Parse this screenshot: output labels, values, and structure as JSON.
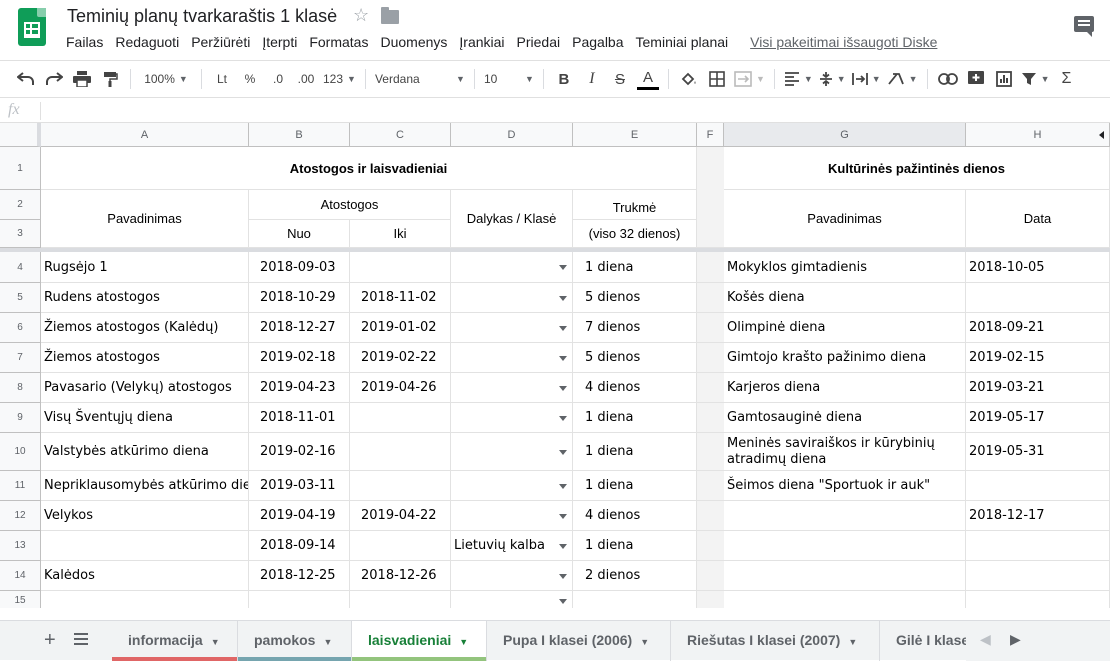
{
  "header": {
    "doc_title": "Teminių planų tvarkaraštis 1 klasė",
    "menu": [
      "Failas",
      "Redaguoti",
      "Peržiūrėti",
      "Įterpti",
      "Formatas",
      "Duomenys",
      "Įrankiai",
      "Priedai",
      "Pagalba",
      "Teminiai planai"
    ],
    "saved_status": "Visi pakeitimai išsaugoti Diske"
  },
  "toolbar": {
    "zoom": "100%",
    "currency": "Lt",
    "percent": "%",
    "dec_less": ".0",
    "dec_more": ".00",
    "number_format": "123",
    "font": "Verdana",
    "font_size": "10",
    "bold": "B",
    "italic": "I",
    "strike": "S",
    "text_color": "A"
  },
  "formula_bar": {
    "fx": "fx",
    "value": ""
  },
  "columns": [
    "A",
    "B",
    "C",
    "D",
    "E",
    "F",
    "G",
    "H"
  ],
  "rows": [
    "1",
    "2",
    "3",
    "4",
    "5",
    "6",
    "7",
    "8",
    "9",
    "10",
    "11",
    "12",
    "13",
    "14",
    "15"
  ],
  "left_table": {
    "title": "Atostogos ir laisvadieniai",
    "h_name": "Pavadinimas",
    "h_vacation": "Atostogos",
    "h_from": "Nuo",
    "h_to": "Iki",
    "h_subject": "Dalykas / Klasė",
    "h_duration": "Trukmė",
    "h_duration_sub": "(viso 32 dienos)",
    "rows": [
      {
        "name": "Rugsėjo 1",
        "from": "2018-09-03",
        "to": "",
        "subject": "",
        "duration": "1 diena"
      },
      {
        "name": "Rudens atostogos",
        "from": "2018-10-29",
        "to": "2018-11-02",
        "subject": "",
        "duration": "5 dienos"
      },
      {
        "name": "Žiemos atostogos (Kalėdų)",
        "from": "2018-12-27",
        "to": "2019-01-02",
        "subject": "",
        "duration": "7 dienos"
      },
      {
        "name": "Žiemos atostogos",
        "from": "2019-02-18",
        "to": "2019-02-22",
        "subject": "",
        "duration": "5 dienos"
      },
      {
        "name": "Pavasario (Velykų) atostogos",
        "from": "2019-04-23",
        "to": "2019-04-26",
        "subject": "",
        "duration": "4 dienos"
      },
      {
        "name": "Visų Šventųjų diena",
        "from": "2018-11-01",
        "to": "",
        "subject": "",
        "duration": "1 diena"
      },
      {
        "name": "Valstybės atkūrimo diena",
        "from": "2019-02-16",
        "to": "",
        "subject": "",
        "duration": "1 diena"
      },
      {
        "name": "Nepriklausomybės atkūrimo diena",
        "from": "2019-03-11",
        "to": "",
        "subject": "",
        "duration": "1 diena"
      },
      {
        "name": "Velykos",
        "from": "2019-04-19",
        "to": "2019-04-22",
        "subject": "",
        "duration": "4 dienos"
      },
      {
        "name": "",
        "from": "2018-09-14",
        "to": "",
        "subject": "Lietuvių kalba",
        "duration": "1 diena"
      },
      {
        "name": "Kalėdos",
        "from": "2018-12-25",
        "to": "2018-12-26",
        "subject": "",
        "duration": "2 dienos"
      },
      {
        "name": "",
        "from": "",
        "to": "",
        "subject": "",
        "duration": ""
      }
    ]
  },
  "right_table": {
    "title": "Kultūrinės pažintinės dienos",
    "h_name": "Pavadinimas",
    "h_date": "Data",
    "rows": [
      {
        "name": "Mokyklos gimtadienis",
        "date": "2018-10-05"
      },
      {
        "name": "Košės diena",
        "date": ""
      },
      {
        "name": "Olimpinė diena",
        "date": "2018-09-21"
      },
      {
        "name": "Gimtojo krašto pažinimo diena",
        "date": "2019-02-15"
      },
      {
        "name": "Karjeros diena",
        "date": "2019-03-21"
      },
      {
        "name": "Gamtosauginė diena",
        "date": "2019-05-17"
      },
      {
        "name": "Meninės saviraiškos ir kūrybinių atradimų diena",
        "date": "2019-05-31"
      },
      {
        "name": "Šeimos diena \"Sportuok ir auk\"",
        "date": ""
      },
      {
        "name": "",
        "date": "2018-12-17"
      },
      {
        "name": "",
        "date": ""
      },
      {
        "name": "",
        "date": ""
      },
      {
        "name": "",
        "date": ""
      }
    ]
  },
  "sheets": [
    {
      "label": "informacija",
      "color": "#e06666"
    },
    {
      "label": "pamokos",
      "color": "#76a5af"
    },
    {
      "label": "laisvadieniai",
      "color": "#93c47d",
      "active": true
    },
    {
      "label": "Pupa I klasei (2006)",
      "color": ""
    },
    {
      "label": "Riešutas I klasei (2007)",
      "color": ""
    },
    {
      "label": "Gilė I klasei",
      "color": ""
    }
  ]
}
